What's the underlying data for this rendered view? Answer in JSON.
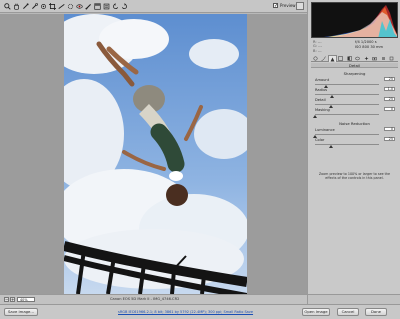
{
  "toolbar": {
    "tools": [
      "zoom-icon",
      "hand-icon",
      "white-balance-icon",
      "color-sampler-icon",
      "target-adjust-icon",
      "crop-icon",
      "straighten-icon",
      "spot-removal-icon",
      "red-eye-icon",
      "adjustment-brush-icon",
      "graduated-filter-icon",
      "preferences-icon",
      "rotate-left-icon",
      "rotate-right-icon"
    ],
    "preview_label": "Preview",
    "preview_checked": true
  },
  "readout": {
    "rgb": [
      "R:  ---",
      "G:  ---",
      "B:  ---"
    ],
    "exif1": "f/4  1/2000 s",
    "exif2": "ISO 800   30 mm"
  },
  "panel": {
    "title": "Detail",
    "sharpening": {
      "title": "Sharpening",
      "amount": {
        "label": "Amount",
        "value": "25",
        "fraction": 0.17
      },
      "radius": {
        "label": "Radius",
        "value": "1.0",
        "fraction": 0.27
      },
      "detail": {
        "label": "Detail",
        "value": "25",
        "fraction": 0.25
      },
      "masking": {
        "label": "Masking",
        "value": "0",
        "fraction": 0.0
      }
    },
    "noise": {
      "title": "Noise Reduction",
      "luminance": {
        "label": "Luminance",
        "value": "0",
        "fraction": 0.0
      },
      "color": {
        "label": "Color",
        "value": "25",
        "fraction": 0.25
      }
    },
    "hint": "Zoom preview to 100% or larger to see the effects of the controls in this panel."
  },
  "status": {
    "zoom": "40%",
    "filename": "Canon EOS 5D Mark II  -  IMG_4746.CR2"
  },
  "bottom": {
    "save_label": "Save Image...",
    "workflow": "sRGB IEC61966-2.1; 8 bit; 3861 by 5792 (22.4MP); 300 ppi; Small Ratio Save",
    "open_label": "Open Image",
    "cancel_label": "Cancel",
    "done_label": "Done"
  }
}
